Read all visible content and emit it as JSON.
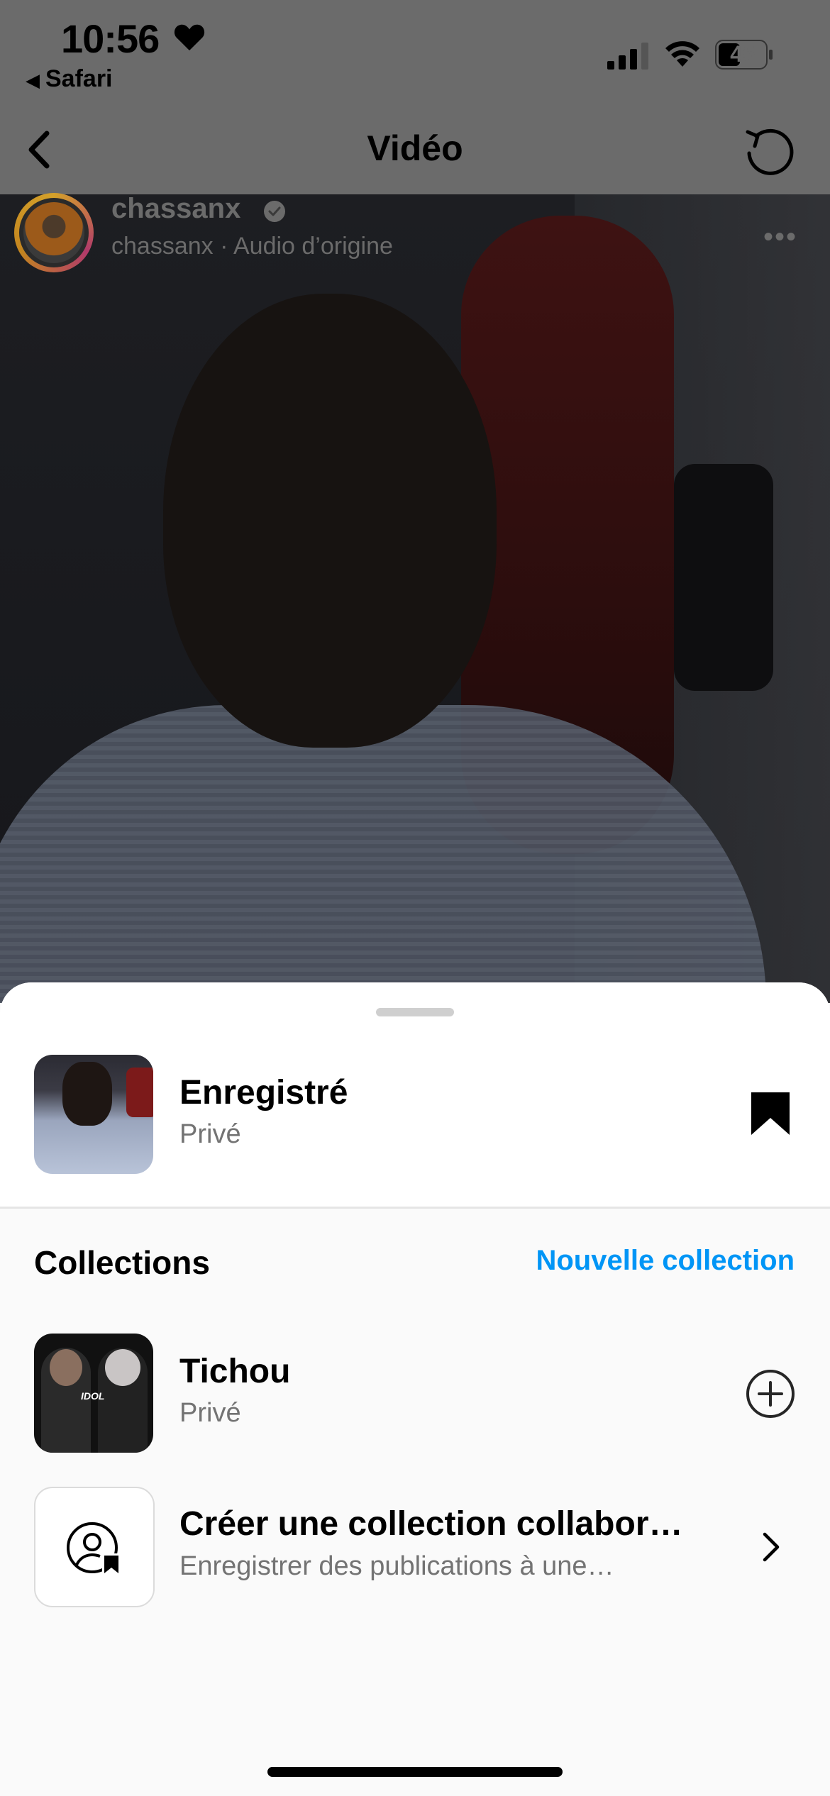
{
  "status_bar": {
    "time": "10:56",
    "back_app": "Safari",
    "battery": "45"
  },
  "nav": {
    "title": "Vidéo"
  },
  "post": {
    "username": "chassanx",
    "audio": "chassanx · Audio d’origine",
    "more": "•••"
  },
  "sheet": {
    "saved": {
      "title": "Enregistré",
      "privacy": "Privé"
    },
    "collections_label": "Collections",
    "new_collection_label": "Nouvelle collection",
    "collections": [
      {
        "title": "Tichou",
        "privacy": "Privé"
      }
    ],
    "collab": {
      "title": "Créer une collection collabor…",
      "subtitle": "Enregistrer des publications à une…"
    }
  },
  "colors": {
    "accent": "#0095f6",
    "overlay": "#6b6b6b",
    "secondary_text": "#737373"
  }
}
